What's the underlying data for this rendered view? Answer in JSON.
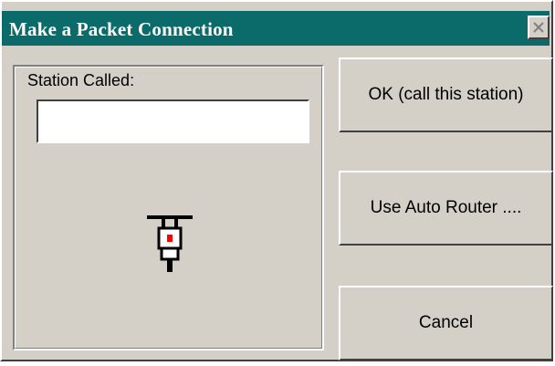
{
  "window": {
    "title": "Make a  Packet Connection"
  },
  "form": {
    "station_label": "Station Called:",
    "station_value": ""
  },
  "buttons": {
    "ok": "OK (call this station)",
    "auto_router": "Use Auto Router ....",
    "cancel": "Cancel"
  },
  "icons": {
    "close": "close-icon",
    "radio": "radio-plug-icon"
  },
  "colors": {
    "titlebar": "#0b6a6a",
    "face": "#d4d0c8",
    "icon_accent": "#ff0000"
  }
}
